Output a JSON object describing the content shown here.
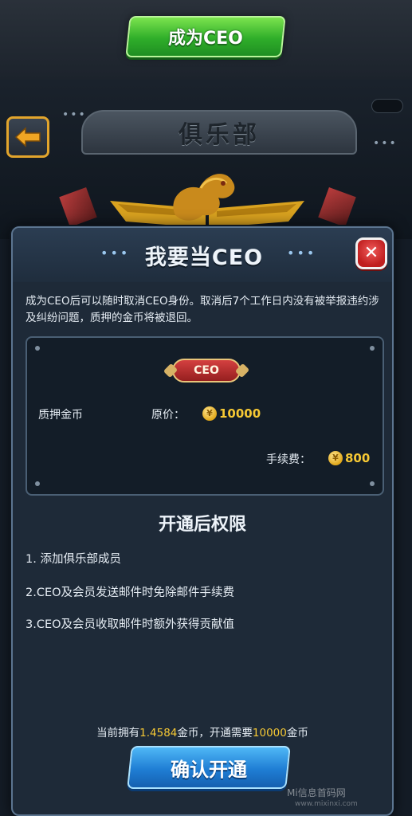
{
  "top_button": {
    "label": "成为CEO"
  },
  "club": {
    "title": "俱乐部"
  },
  "dialog": {
    "title": "我要当CEO",
    "close_icon": "close-x-icon",
    "description": "成为CEO后可以随时取消CEO身份。取消后7个工作日内没有被举报违约涉及纠纷问题，质押的金币将被退回。",
    "badge": "CEO",
    "deposit_label": "质押金币",
    "original_label": "原价：",
    "original_amount": "10000",
    "fee_label": "手续费：",
    "fee_amount": "800",
    "coin_symbol": "¥",
    "permissions_title": "开通后权限",
    "permissions": [
      "1. 添加俱乐部成员",
      "2.CEO及会员发送邮件时免除邮件手续费",
      "3.CEO及会员收取邮件时额外获得贡献值"
    ],
    "footer": {
      "prefix": "当前拥有",
      "owned": "1.4584",
      "middle": "金币，开通需要",
      "required": "10000",
      "suffix": "金币"
    },
    "confirm_label": "确认开通"
  },
  "watermark": {
    "text": "Mi信息首码网",
    "url": "www.mixinxi.com"
  },
  "colors": {
    "gold": "#f7c934",
    "green_button": "#2fae2a",
    "blue_button": "#1f7ed4",
    "close_red": "#c01f1f"
  }
}
